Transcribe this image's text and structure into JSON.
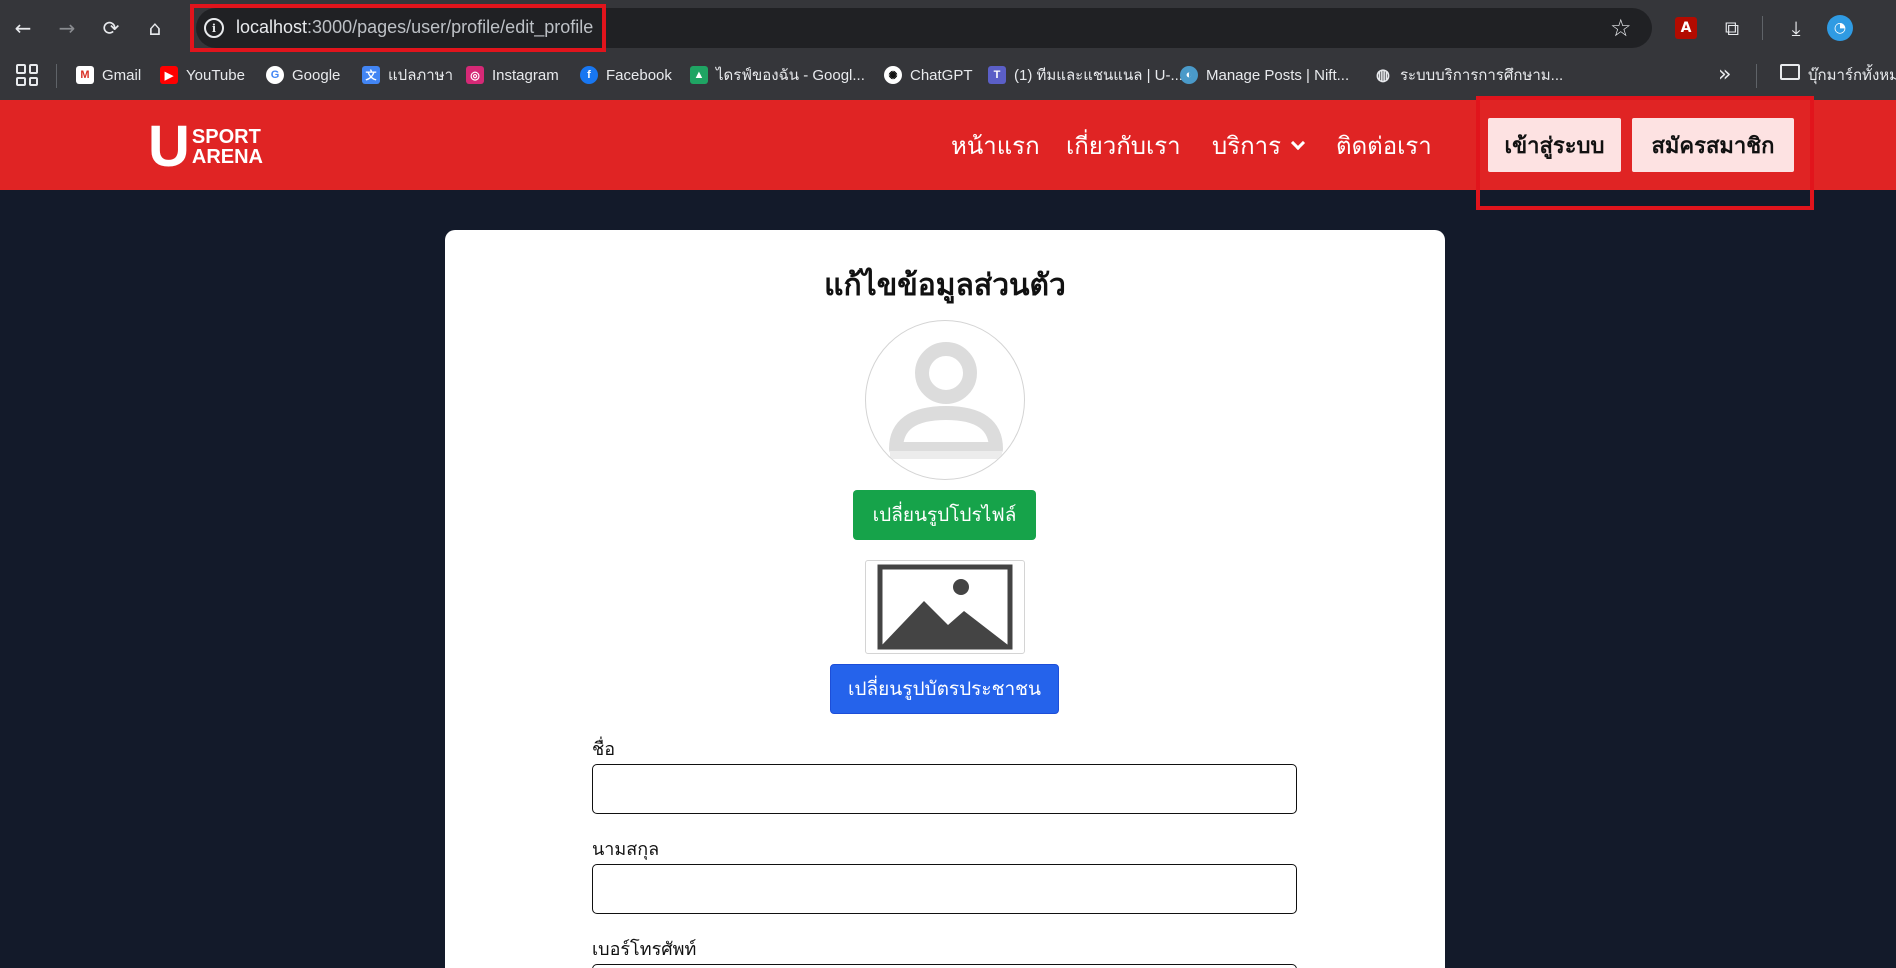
{
  "browser": {
    "url_host": "localhost",
    "url_path": ":3000/pages/user/profile/edit_profile",
    "bookmarks": [
      {
        "label": "Gmail",
        "icon": "gmail-icon"
      },
      {
        "label": "YouTube",
        "icon": "youtube-icon"
      },
      {
        "label": "Google",
        "icon": "google-icon"
      },
      {
        "label": "แปลภาษา",
        "icon": "translate-icon"
      },
      {
        "label": "Instagram",
        "icon": "instagram-icon"
      },
      {
        "label": "Facebook",
        "icon": "facebook-icon"
      },
      {
        "label": "ไดรฟ์ของฉัน - Googl...",
        "icon": "drive-icon"
      },
      {
        "label": "ChatGPT",
        "icon": "chatgpt-icon"
      },
      {
        "label": "(1) ทีมและแชนแนล | U-...",
        "icon": "teams-icon"
      },
      {
        "label": "Manage Posts | Nift...",
        "icon": "nift-icon"
      },
      {
        "label": "ระบบบริการการศึกษาม...",
        "icon": "globe-icon"
      }
    ],
    "all_bookmarks": "บุ๊กมาร์กทั้งหมด"
  },
  "site": {
    "logo_top": "SPORT",
    "logo_bottom": "ARENA",
    "logo_letter": "U",
    "nav": {
      "home": "หน้าแรก",
      "about": "เกี่ยวกับเรา",
      "services": "บริการ",
      "contact": "ติดต่อเรา"
    },
    "login_label": "เข้าสู่ระบบ",
    "register_label": "สมัครสมาชิก"
  },
  "form": {
    "title": "แก้ไขข้อมูลส่วนตัว",
    "change_avatar_label": "เปลี่ยนรูปโปรไฟล์",
    "change_idcard_label": "เปลี่ยนรูปบัตรประชาชน",
    "first_name_label": "ชื่อ",
    "first_name_value": "",
    "last_name_label": "นามสกุล",
    "last_name_value": "",
    "phone_label": "เบอร์โทรศัพท์",
    "phone_value": ""
  },
  "colors": {
    "header_red": "#e02424",
    "page_bg": "#131a2a",
    "green_button": "#16a34a",
    "blue_button": "#2563eb",
    "annotation_red": "#e1141c"
  }
}
